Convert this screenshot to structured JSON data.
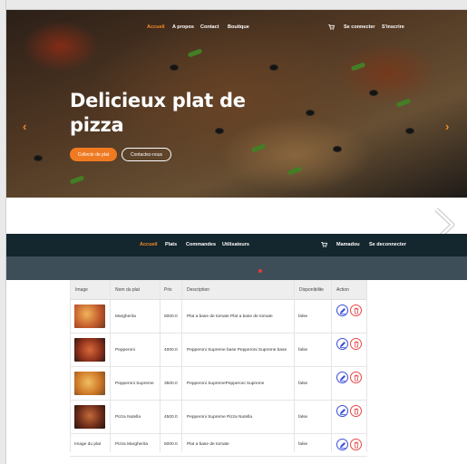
{
  "hero": {
    "nav": {
      "accueil": "Accueil",
      "apropos": "A propos",
      "contact": "Contact",
      "boutique": "Boutique",
      "login": "Se connecter",
      "register": "S'inscrire"
    },
    "title": "Delicieux plat de pizza",
    "btn_primary": "Collecte de plat",
    "btn_secondary": "Contactez-nous"
  },
  "admin_nav": {
    "accueil": "Accueil",
    "plats": "Plats",
    "commandes": "Commandes",
    "utilisateurs": "Utilisateurs",
    "user": "Mamadou",
    "logout": "Se deconnecter"
  },
  "table": {
    "headers": [
      "Image",
      "Nom du plat",
      "Prix",
      "Description",
      "Disponibilite",
      "Action"
    ],
    "rows": [
      {
        "image": "",
        "name": "Margherita",
        "price": "5000.0",
        "description": "Plat a base de tomate Plat a base de tomate",
        "available": "false"
      },
      {
        "image": "",
        "name": "Pepperoni",
        "price": "4000.0",
        "description": "Pepperoni Supreme base Pepperoni Supreme base",
        "available": "false"
      },
      {
        "image": "",
        "name": "Pepperoni Supreme",
        "price": "3500.0",
        "description": "Pepperoni SupremePepperoni Supreme",
        "available": "false"
      },
      {
        "image": "",
        "name": "Pizza Nutella",
        "price": "4500.0",
        "description": "Pepperoni Supreme Pizza Nutella",
        "available": "false"
      },
      {
        "image": "Image du plat",
        "name": "Pizza Margherita",
        "price": "5000.0",
        "description": "Plat a base de tomate",
        "available": "false"
      }
    ]
  },
  "colors": {
    "accent": "#f58b25",
    "nav_bg": "#14262e",
    "band_bg": "#3e4e58",
    "edit": "#3a4fd8",
    "delete": "#e64646"
  },
  "icons": [
    "cart-icon",
    "chevron-left-icon",
    "chevron-right-icon",
    "edit-icon",
    "trash-icon"
  ]
}
